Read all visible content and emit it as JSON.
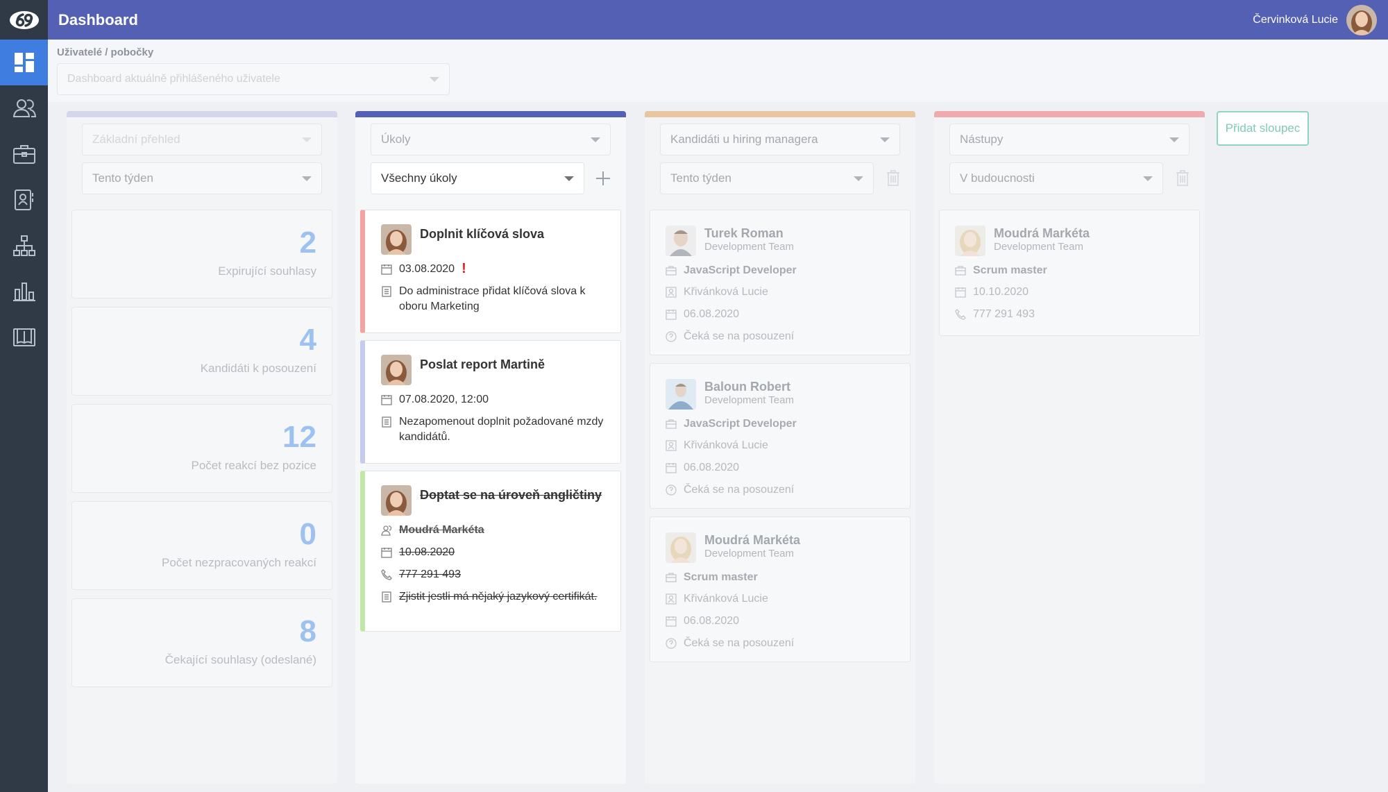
{
  "header": {
    "title": "Dashboard",
    "user_name": "Červinková Lucie"
  },
  "filter": {
    "label": "Uživatelé / pobočky",
    "placeholder": "Dashboard aktuálně přihlášeného uživatele"
  },
  "sidebar": {
    "items": [
      {
        "icon": "dashboard-icon",
        "active": true
      },
      {
        "icon": "users-icon"
      },
      {
        "icon": "briefcase-icon"
      },
      {
        "icon": "contacts-icon"
      },
      {
        "icon": "org-chart-icon"
      },
      {
        "icon": "bar-chart-icon"
      },
      {
        "icon": "book-icon"
      }
    ]
  },
  "columns": [
    {
      "color": "#b9c0e2",
      "select1": "Základní přehled",
      "select2": "Tento týden",
      "stats": [
        {
          "value": "2",
          "label": "Expirující souhlasy"
        },
        {
          "value": "4",
          "label": "Kandidáti k posouzení"
        },
        {
          "value": "12",
          "label": "Počet reakcí bez pozice"
        },
        {
          "value": "0",
          "label": "Počet nezpracovaných reakcí"
        },
        {
          "value": "8",
          "label": "Čekající souhlasy (odeslané)"
        }
      ]
    },
    {
      "color": "#5460b4",
      "select1": "Úkoly",
      "select2": "Všechny úkoly",
      "tasks": [
        {
          "title": "Doplnit klíčová slova",
          "date": "03.08.2020",
          "overdue_mark": "!",
          "note": "Do administrace přidat klíčová slova k oboru Marketing",
          "accent": "#f4a4a0"
        },
        {
          "title": "Poslat report Martině",
          "date": "07.08.2020, 12:00",
          "note": "Nezapomenout doplnit požadované mzdy kandidátů.",
          "accent": "#c6cbee"
        },
        {
          "title": "Doptat se na úroveň angličtiny",
          "person": "Moudrá Markéta",
          "date": "10.08.2020",
          "phone": "777 291 493",
          "note": "Zjistit jestli má nějaký jazykový certifikát.",
          "accent": "#bfe8a6"
        }
      ]
    },
    {
      "color": "#e9c6a2",
      "select1": "Kandidáti u hiring managera",
      "select2": "Tento týden",
      "candidates": [
        {
          "name": "Turek Roman",
          "team": "Development Team",
          "position": "JavaScript Developer",
          "manager": "Křivánková Lucie",
          "date": "06.08.2020",
          "status": "Čeká se na posouzení"
        },
        {
          "name": "Baloun Robert",
          "team": "Development Team",
          "position": "JavaScript Developer",
          "manager": "Křivánková Lucie",
          "date": "06.08.2020",
          "status": "Čeká se na posouzení"
        },
        {
          "name": "Moudrá Markéta",
          "team": "Development Team",
          "position": "Scrum master",
          "manager": "Křivánková Lucie",
          "date": "06.08.2020",
          "status": "Čeká se na posouzení"
        }
      ]
    },
    {
      "color": "#eeaaad",
      "select1": "Nástupy",
      "select2": "V budoucnosti",
      "starts": [
        {
          "name": "Moudrá Markéta",
          "team": "Development Team",
          "position": "Scrum master",
          "date": "10.10.2020",
          "phone": "777 291 493"
        }
      ]
    }
  ],
  "add_column_label": "Přidat sloupec"
}
